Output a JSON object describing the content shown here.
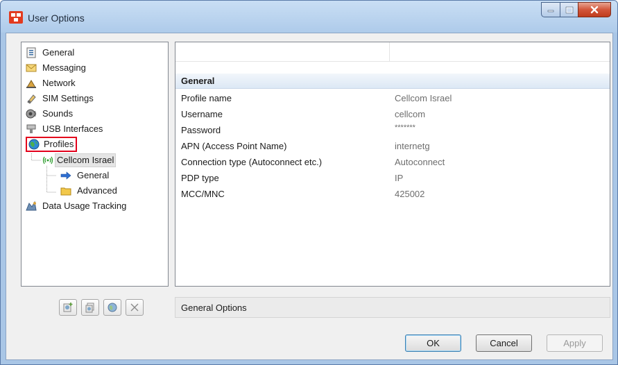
{
  "window": {
    "title": "User Options"
  },
  "tree": {
    "items": [
      {
        "label": "General",
        "icon": "general-settings-icon"
      },
      {
        "label": "Messaging",
        "icon": "envelope-icon"
      },
      {
        "label": "Network",
        "icon": "network-icon"
      },
      {
        "label": "SIM Settings",
        "icon": "sim-card-icon"
      },
      {
        "label": "Sounds",
        "icon": "speaker-icon"
      },
      {
        "label": "USB Interfaces",
        "icon": "usb-icon"
      },
      {
        "label": "Profiles",
        "icon": "globe-icon"
      },
      {
        "label": "Cellcom Israel",
        "icon": "signal-antenna-icon"
      },
      {
        "label": "General",
        "icon": "arrow-right-icon"
      },
      {
        "label": "Advanced",
        "icon": "folder-icon"
      },
      {
        "label": "Data Usage Tracking",
        "icon": "data-usage-icon"
      }
    ]
  },
  "details": {
    "group": "General",
    "rows": [
      {
        "name": "Profile name",
        "value": "Cellcom Israel"
      },
      {
        "name": "Username",
        "value": "cellcom"
      },
      {
        "name": "Password",
        "value": "*******"
      },
      {
        "name": "APN (Access Point Name)",
        "value": "internetg"
      },
      {
        "name": "Connection type (Autoconnect etc.)",
        "value": "Autoconnect"
      },
      {
        "name": "PDP type",
        "value": "IP"
      },
      {
        "name": "MCC/MNC",
        "value": "425002"
      }
    ]
  },
  "description": "General Options",
  "buttons": {
    "ok": "OK",
    "cancel": "Cancel",
    "apply": "Apply"
  },
  "colors": {
    "highlight_box": "#e3001b",
    "title_bar": "#aecbea",
    "close_button": "#d2553a"
  }
}
